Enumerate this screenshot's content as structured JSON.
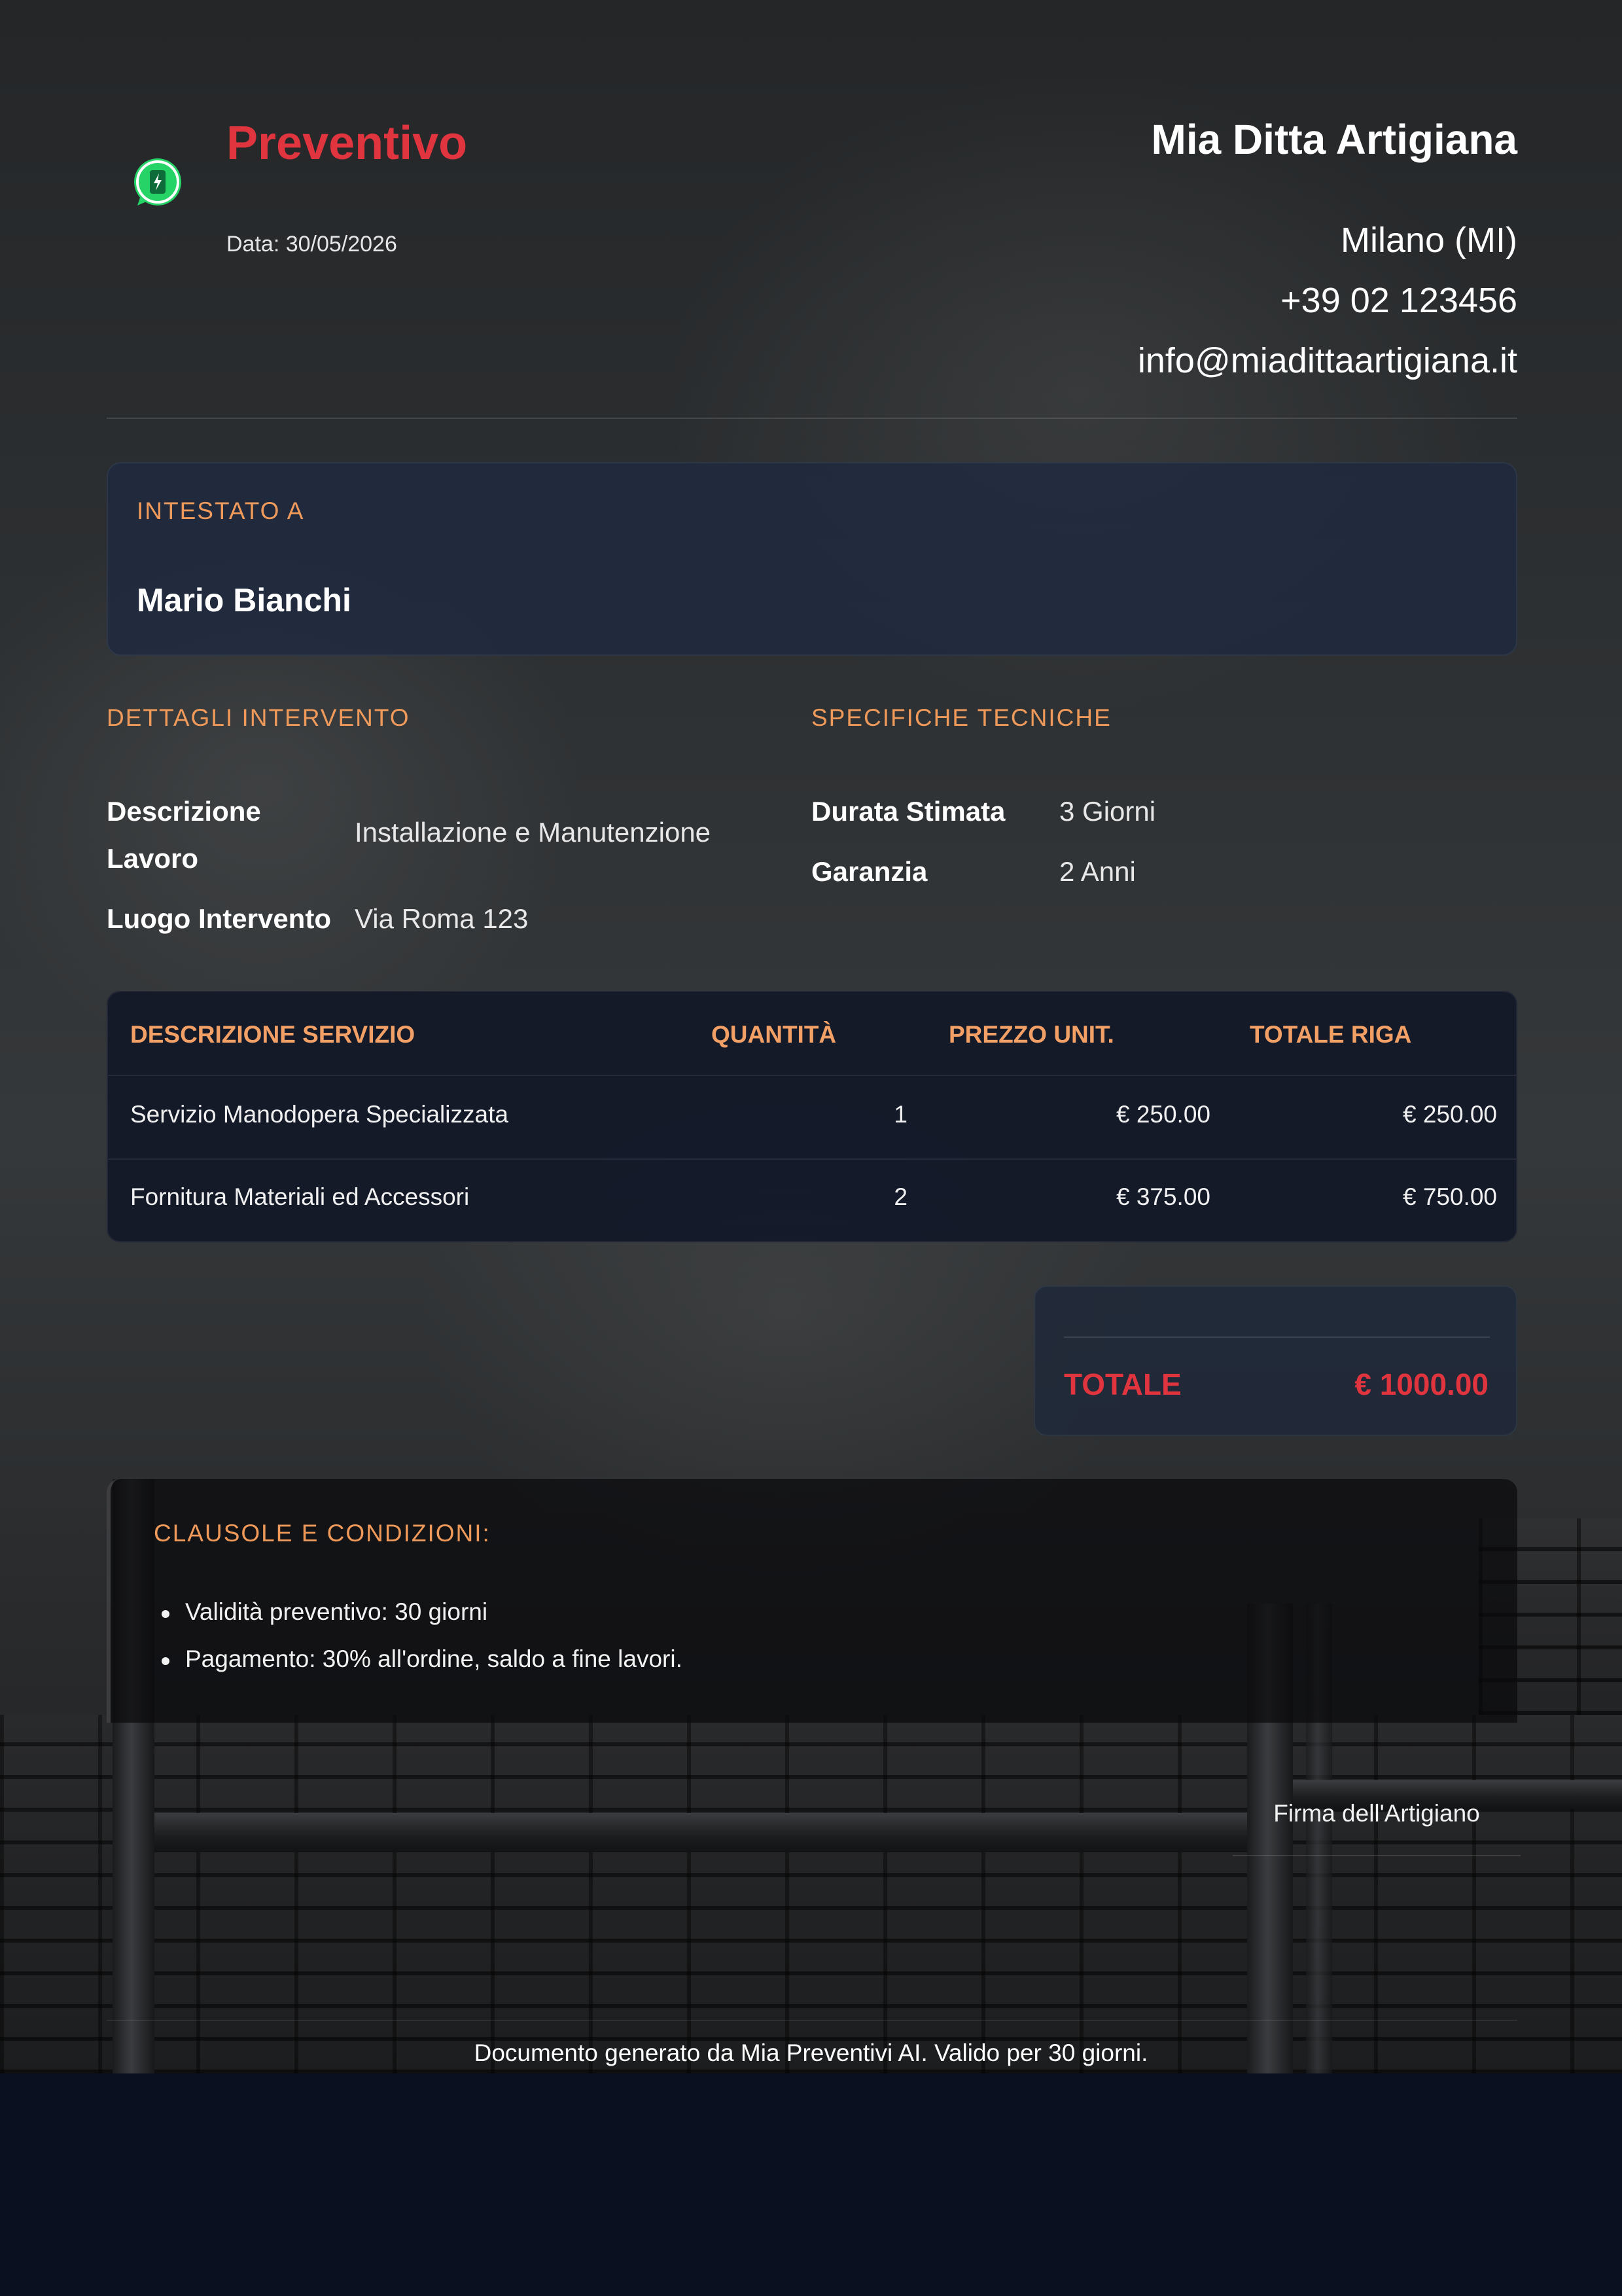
{
  "header": {
    "title": "Preventivo",
    "date": "Data: 30/05/2026",
    "company_name": "Mia Ditta Artigiana",
    "city": "Milano (MI)",
    "phone": "+39 02 123456",
    "email": "info@miadittaartigiana.it"
  },
  "client": {
    "label": "INTESTATO A",
    "name": "Mario Bianchi"
  },
  "details": {
    "label": "DETTAGLI INTERVENTO",
    "description_key": "Descrizione Lavoro",
    "description_key_line1": "Descrizione",
    "description_key_line2": "Lavoro",
    "description_value": "Installazione e Manutenzione",
    "location_key": "Luogo Intervento",
    "location_value": "Via Roma 123"
  },
  "specs": {
    "label": "SPECIFICHE TECNICHE",
    "duration_key": "Durata Stimata",
    "duration_value": "3 Giorni",
    "warranty_key": "Garanzia",
    "warranty_value": "2 Anni"
  },
  "table": {
    "headers": [
      "DESCRIZIONE SERVIZIO",
      "QUANTITÀ",
      "PREZZO UNIT.",
      "TOTALE RIGA"
    ],
    "rows": [
      {
        "description": "Servizio Manodopera Specializzata",
        "qty": "1",
        "unit_price": "€ 250.00",
        "line_total": "€ 250.00"
      },
      {
        "description": "Fornitura Materiali ed Accessori",
        "qty": "2",
        "unit_price": "€ 375.00",
        "line_total": "€ 750.00"
      }
    ]
  },
  "totals": {
    "label": "TOTALE",
    "value": "€ 1000.00"
  },
  "conditions": {
    "label": "CLAUSOLE E CONDIZIONI:",
    "items": [
      "Validità preventivo: 30 giorni",
      "Pagamento: 30% all'ordine, saldo a fine lavori."
    ]
  },
  "signature": {
    "label": "Firma dell'Artigiano"
  },
  "footer": {
    "text": "Documento generato da Mia Preventivi AI. Valido per 30 giorni."
  },
  "icons": {
    "floating": "whatsapp-icon"
  },
  "colors": {
    "accent_red": "#e0343f",
    "accent_orange": "#ef9a5a",
    "whatsapp_green": "#25d366"
  }
}
